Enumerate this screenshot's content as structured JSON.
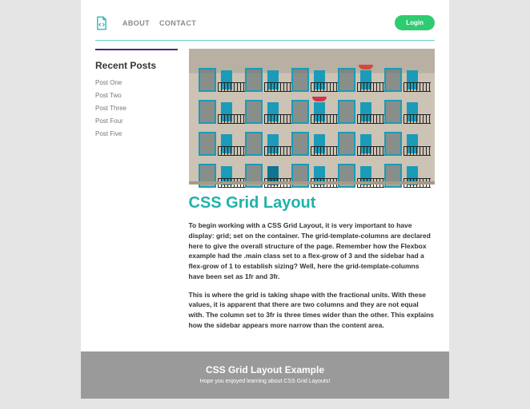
{
  "header": {
    "nav": [
      "ABOUT",
      "CONTACT"
    ],
    "login_label": "Login"
  },
  "sidebar": {
    "title": "Recent Posts",
    "posts": [
      "Post One",
      "Post Two",
      "Post Three",
      "Post Four",
      "Post Five"
    ]
  },
  "article": {
    "title": "CSS Grid Layout",
    "p1": "To begin working with a CSS Grid Layout, it is very important to have display: grid; set on the container. The grid-template-columns are declared here to give the overall structure of the page. Remember how the Flexbox example had the .main class set to a flex-grow of 3 and the sidebar had a flex-grow of 1 to establish sizing? Well, here the grid-template-columns have been set as 1fr and 3fr.",
    "p2": "This is where the grid is taking shape with the fractional units. With these values, it is apparent that there are two columns and they are not equal with. The column set to 3fr is three times wider than the other. This explains how the sidebar appears more narrow than the content area."
  },
  "footer": {
    "title": "CSS Grid Layout Example",
    "sub": "Hope you enjoyed learning about CSS Grid Layouts!"
  },
  "colors": {
    "accent": "#20b2aa",
    "button": "#2ecc71",
    "sidebar_border": "#4a2a7a"
  }
}
